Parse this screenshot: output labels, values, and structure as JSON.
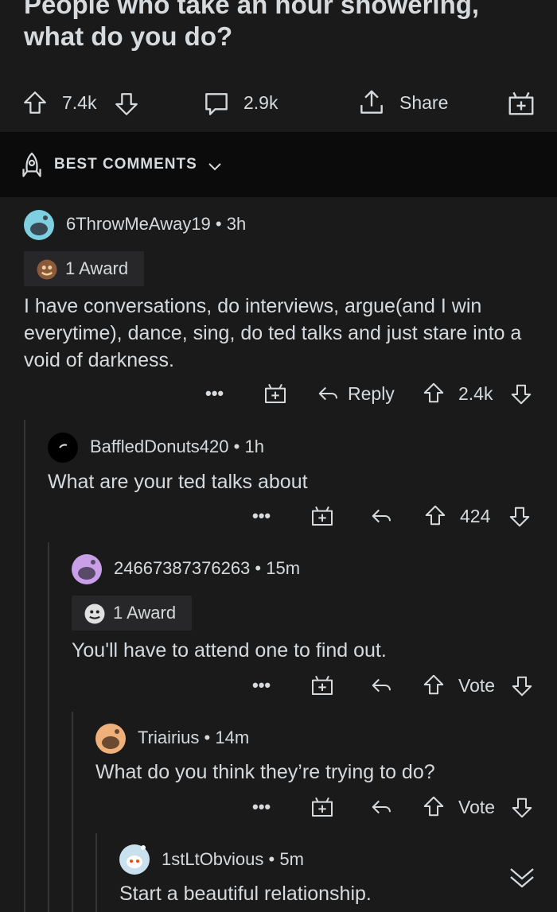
{
  "post": {
    "title": "People who take an hour showering, what do you do?",
    "upvotes": "7.4k",
    "comments": "2.9k",
    "share_label": "Share"
  },
  "sort": {
    "label": "BEST COMMENTS"
  },
  "comments": [
    {
      "author": "6ThrowMeAway19",
      "age": "3h",
      "award": "1 Award",
      "text": "I have conversations, do interviews, argue(and I win everytime), dance, sing, do ted talks and just stare into a void of darkness.",
      "more": "•••",
      "reply_label": "Reply",
      "score": "2.4k"
    },
    {
      "author": "BaffledDonuts420",
      "age": "1h",
      "text": "What are your ted talks about",
      "more": "•••",
      "score": "424"
    },
    {
      "author": "24667387376263",
      "age": "15m",
      "award": "1 Award",
      "text": "You'll have to attend one to find out.",
      "more": "•••",
      "score": "Vote"
    },
    {
      "author": "Triairius",
      "age": "14m",
      "text": "What do you think they’re trying to do?",
      "more": "•••",
      "score": "Vote"
    },
    {
      "author": "1stLtObvious",
      "age": "5m",
      "text": "Start a beautiful relationship."
    }
  ],
  "colors": {
    "background": "#1a1a1b",
    "sort_bar": "#0b0b0c",
    "text": "#d7dadc",
    "thread_line": "#343536",
    "avatar_1": "#7ecfe0",
    "avatar_3": "#c9a0e8",
    "avatar_4": "#f0b07a"
  }
}
